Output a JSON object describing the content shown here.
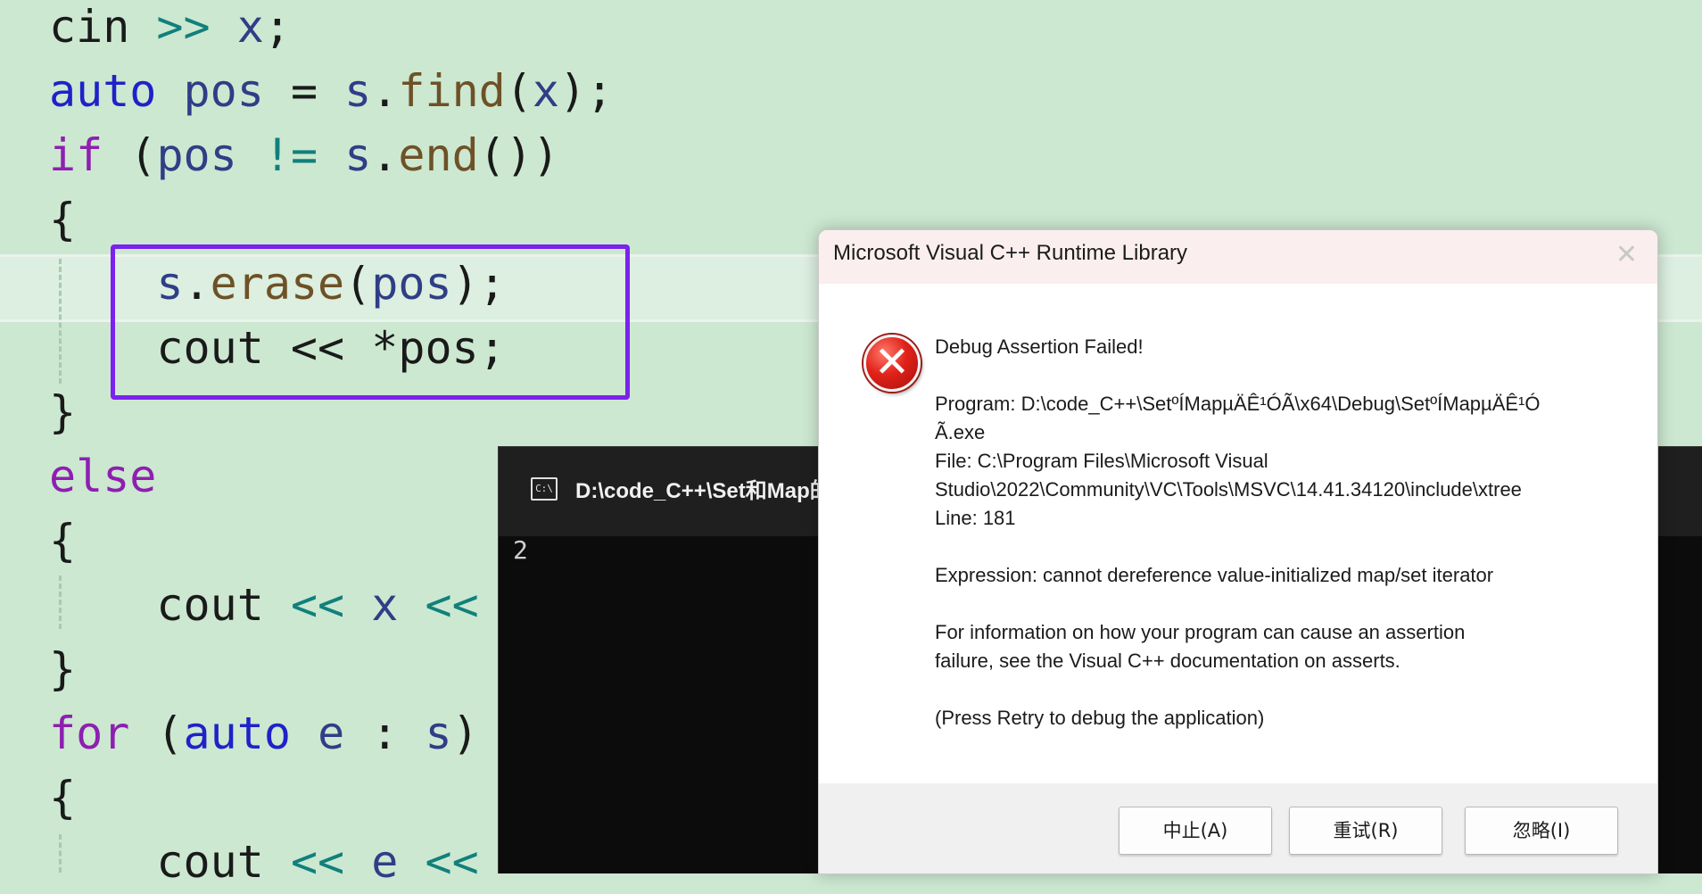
{
  "editor": {
    "lines": [
      [
        {
          "t": "cin",
          "c": "pl"
        },
        {
          "t": " ",
          "c": "pl"
        },
        {
          "t": ">>",
          "c": "op"
        },
        {
          "t": " ",
          "c": "pl"
        },
        {
          "t": "x",
          "c": "var"
        },
        {
          "t": ";",
          "c": "pl"
        }
      ],
      [
        {
          "t": "auto",
          "c": "kw"
        },
        {
          "t": " ",
          "c": "pl"
        },
        {
          "t": "pos",
          "c": "var"
        },
        {
          "t": " = ",
          "c": "pl"
        },
        {
          "t": "s",
          "c": "var"
        },
        {
          "t": ".",
          "c": "pl"
        },
        {
          "t": "find",
          "c": "fn"
        },
        {
          "t": "(",
          "c": "pl"
        },
        {
          "t": "x",
          "c": "var"
        },
        {
          "t": ");",
          "c": "pl"
        }
      ],
      [
        {
          "t": "if",
          "c": "ctl"
        },
        {
          "t": " (",
          "c": "pl"
        },
        {
          "t": "pos",
          "c": "var"
        },
        {
          "t": " ",
          "c": "pl"
        },
        {
          "t": "!=",
          "c": "op"
        },
        {
          "t": " ",
          "c": "pl"
        },
        {
          "t": "s",
          "c": "var"
        },
        {
          "t": ".",
          "c": "pl"
        },
        {
          "t": "end",
          "c": "fn"
        },
        {
          "t": "())",
          "c": "pl"
        }
      ],
      [
        {
          "t": "{",
          "c": "pl"
        }
      ],
      [
        {
          "t": "    ",
          "c": "pl"
        },
        {
          "t": "s",
          "c": "var"
        },
        {
          "t": ".",
          "c": "pl"
        },
        {
          "t": "erase",
          "c": "fn"
        },
        {
          "t": "(",
          "c": "pl"
        },
        {
          "t": "pos",
          "c": "var"
        },
        {
          "t": ");",
          "c": "pl"
        }
      ],
      [
        {
          "t": "    cout << *",
          "c": "pl"
        },
        {
          "t": "pos",
          "c": "pl"
        },
        {
          "t": ";",
          "c": "pl"
        }
      ],
      [
        {
          "t": "}",
          "c": "pl"
        }
      ],
      [
        {
          "t": "else",
          "c": "ctl"
        }
      ],
      [
        {
          "t": "{",
          "c": "pl"
        }
      ],
      [
        {
          "t": "    cout ",
          "c": "pl"
        },
        {
          "t": "<<",
          "c": "op"
        },
        {
          "t": " ",
          "c": "pl"
        },
        {
          "t": "x",
          "c": "var"
        },
        {
          "t": " ",
          "c": "pl"
        },
        {
          "t": "<<",
          "c": "op"
        }
      ],
      [
        {
          "t": "}",
          "c": "pl"
        }
      ],
      [
        {
          "t": "for",
          "c": "ctl"
        },
        {
          "t": " (",
          "c": "pl"
        },
        {
          "t": "auto",
          "c": "kw"
        },
        {
          "t": " ",
          "c": "pl"
        },
        {
          "t": "e",
          "c": "var"
        },
        {
          "t": " : ",
          "c": "pl"
        },
        {
          "t": "s",
          "c": "var"
        },
        {
          "t": ")",
          "c": "pl"
        }
      ],
      [
        {
          "t": "{",
          "c": "pl"
        }
      ],
      [
        {
          "t": "    cout ",
          "c": "pl"
        },
        {
          "t": "<<",
          "c": "op"
        },
        {
          "t": " ",
          "c": "pl"
        },
        {
          "t": "e",
          "c": "var"
        },
        {
          "t": " ",
          "c": "pl"
        },
        {
          "t": "<<",
          "c": "op"
        }
      ]
    ]
  },
  "console": {
    "title": "D:\\code_C++\\Set和Map的",
    "icon_label": "C:\\",
    "output": "2"
  },
  "dialog": {
    "title": "Microsoft Visual C++ Runtime Library",
    "close": "✕",
    "icon": "✕",
    "heading": "Debug Assertion Failed!",
    "program_line1": "Program: D:\\code_C++\\SetºÍMapµÄÊ¹ÓÃ\\x64\\Debug\\SetºÍMapµÄÊ¹Ó",
    "program_line2": "Ã.exe",
    "file_line1": "File: C:\\Program Files\\Microsoft Visual",
    "file_line2": "Studio\\2022\\Community\\VC\\Tools\\MSVC\\14.41.34120\\include\\xtree",
    "line": "Line: 181",
    "expression": "Expression: cannot dereference value-initialized map/set iterator",
    "info_line1": "For information on how your program can cause an assertion",
    "info_line2": "failure, see the Visual C++ documentation on asserts.",
    "retry_hint": "(Press Retry to debug the application)",
    "buttons": {
      "abort": "中止(A)",
      "retry": "重试(R)",
      "ignore": "忽略(I)"
    }
  }
}
